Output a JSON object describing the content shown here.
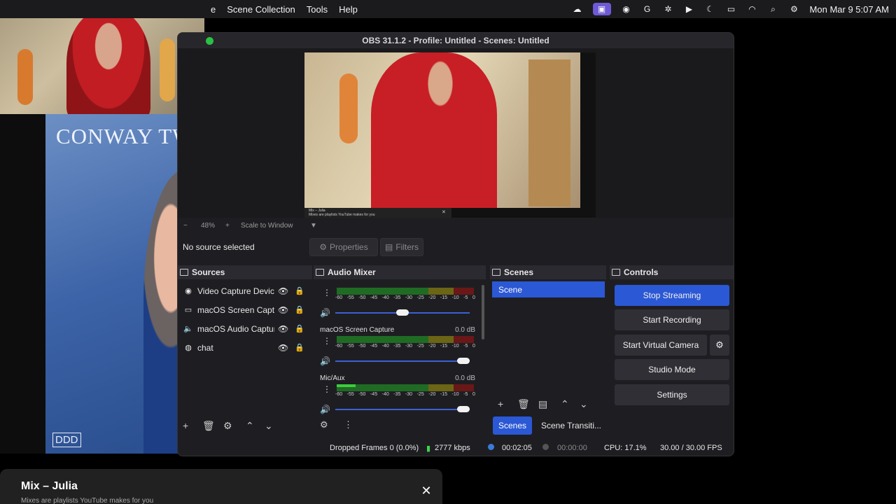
{
  "menubar": {
    "items": [
      "e",
      "Scene Collection",
      "Tools",
      "Help"
    ],
    "datetime": "Mon Mar 9  5:07 AM",
    "icons": [
      "cloud-sync-icon",
      "screen-share-icon",
      "record-icon",
      "grammarly-icon",
      "settings-icon",
      "play-icon",
      "moon-icon",
      "battery-icon",
      "wifi-icon",
      "search-icon",
      "control-center-icon"
    ]
  },
  "album": {
    "title": "CONWAY TW",
    "logo": "DDD"
  },
  "toast": {
    "title": "Mix – Julia",
    "subtitle": "Mixes are playlists YouTube makes for you"
  },
  "obs": {
    "title": "OBS 31.1.2 - Profile: Untitled - Scenes: Untitled",
    "preview_bar_title": "Mix – Julia",
    "preview_bar_sub": "Mixes are playlists YouTube makes for you",
    "zoom": {
      "minus": "−",
      "level": "48%",
      "plus": "+",
      "scale_label": "Scale to Window"
    },
    "no_source": "No source selected",
    "properties_label": "Properties",
    "filters_label": "Filters",
    "sources": {
      "title": "Sources",
      "items": [
        {
          "icon": "camera-icon",
          "glyph": "◉",
          "name": "Video Capture Device"
        },
        {
          "icon": "monitor-icon",
          "glyph": "▭",
          "name": "macOS Screen Captur"
        },
        {
          "icon": "speaker-icon",
          "glyph": "🔈",
          "name": "macOS Audio Capture"
        },
        {
          "icon": "browser-icon",
          "glyph": "◍",
          "name": "chat"
        }
      ]
    },
    "mixer": {
      "title": "Audio Mixer",
      "scale": [
        "-60",
        "-55",
        "-50",
        "-45",
        "-40",
        "-35",
        "-30",
        "-25",
        "-20",
        "-15",
        "-10",
        "-5",
        "0"
      ],
      "channels": [
        {
          "name": "",
          "db": "",
          "level": 0.0,
          "fader": 0.5
        },
        {
          "name": "macOS Screen Capture",
          "db": "0.0 dB",
          "level": 0.0,
          "fader": 1.0
        },
        {
          "name": "Mic/Aux",
          "db": "0.0 dB",
          "level": 0.14,
          "fader": 1.0
        }
      ]
    },
    "scenes": {
      "title": "Scenes",
      "items": [
        "Scene"
      ]
    },
    "controls": {
      "title": "Controls",
      "stop_streaming": "Stop Streaming",
      "start_recording": "Start Recording",
      "start_virtual_camera": "Start Virtual Camera",
      "studio_mode": "Studio Mode",
      "settings": "Settings"
    },
    "tabs": {
      "scenes": "Scenes",
      "transitions": "Scene Transiti..."
    },
    "status": {
      "dropped": "Dropped Frames 0 (0.0%)",
      "bitrate": "2777 kbps",
      "stream_time": "00:02:05",
      "record_time": "00:00:00",
      "cpu": "CPU: 17.1%",
      "fps": "30.00 / 30.00 FPS"
    }
  }
}
